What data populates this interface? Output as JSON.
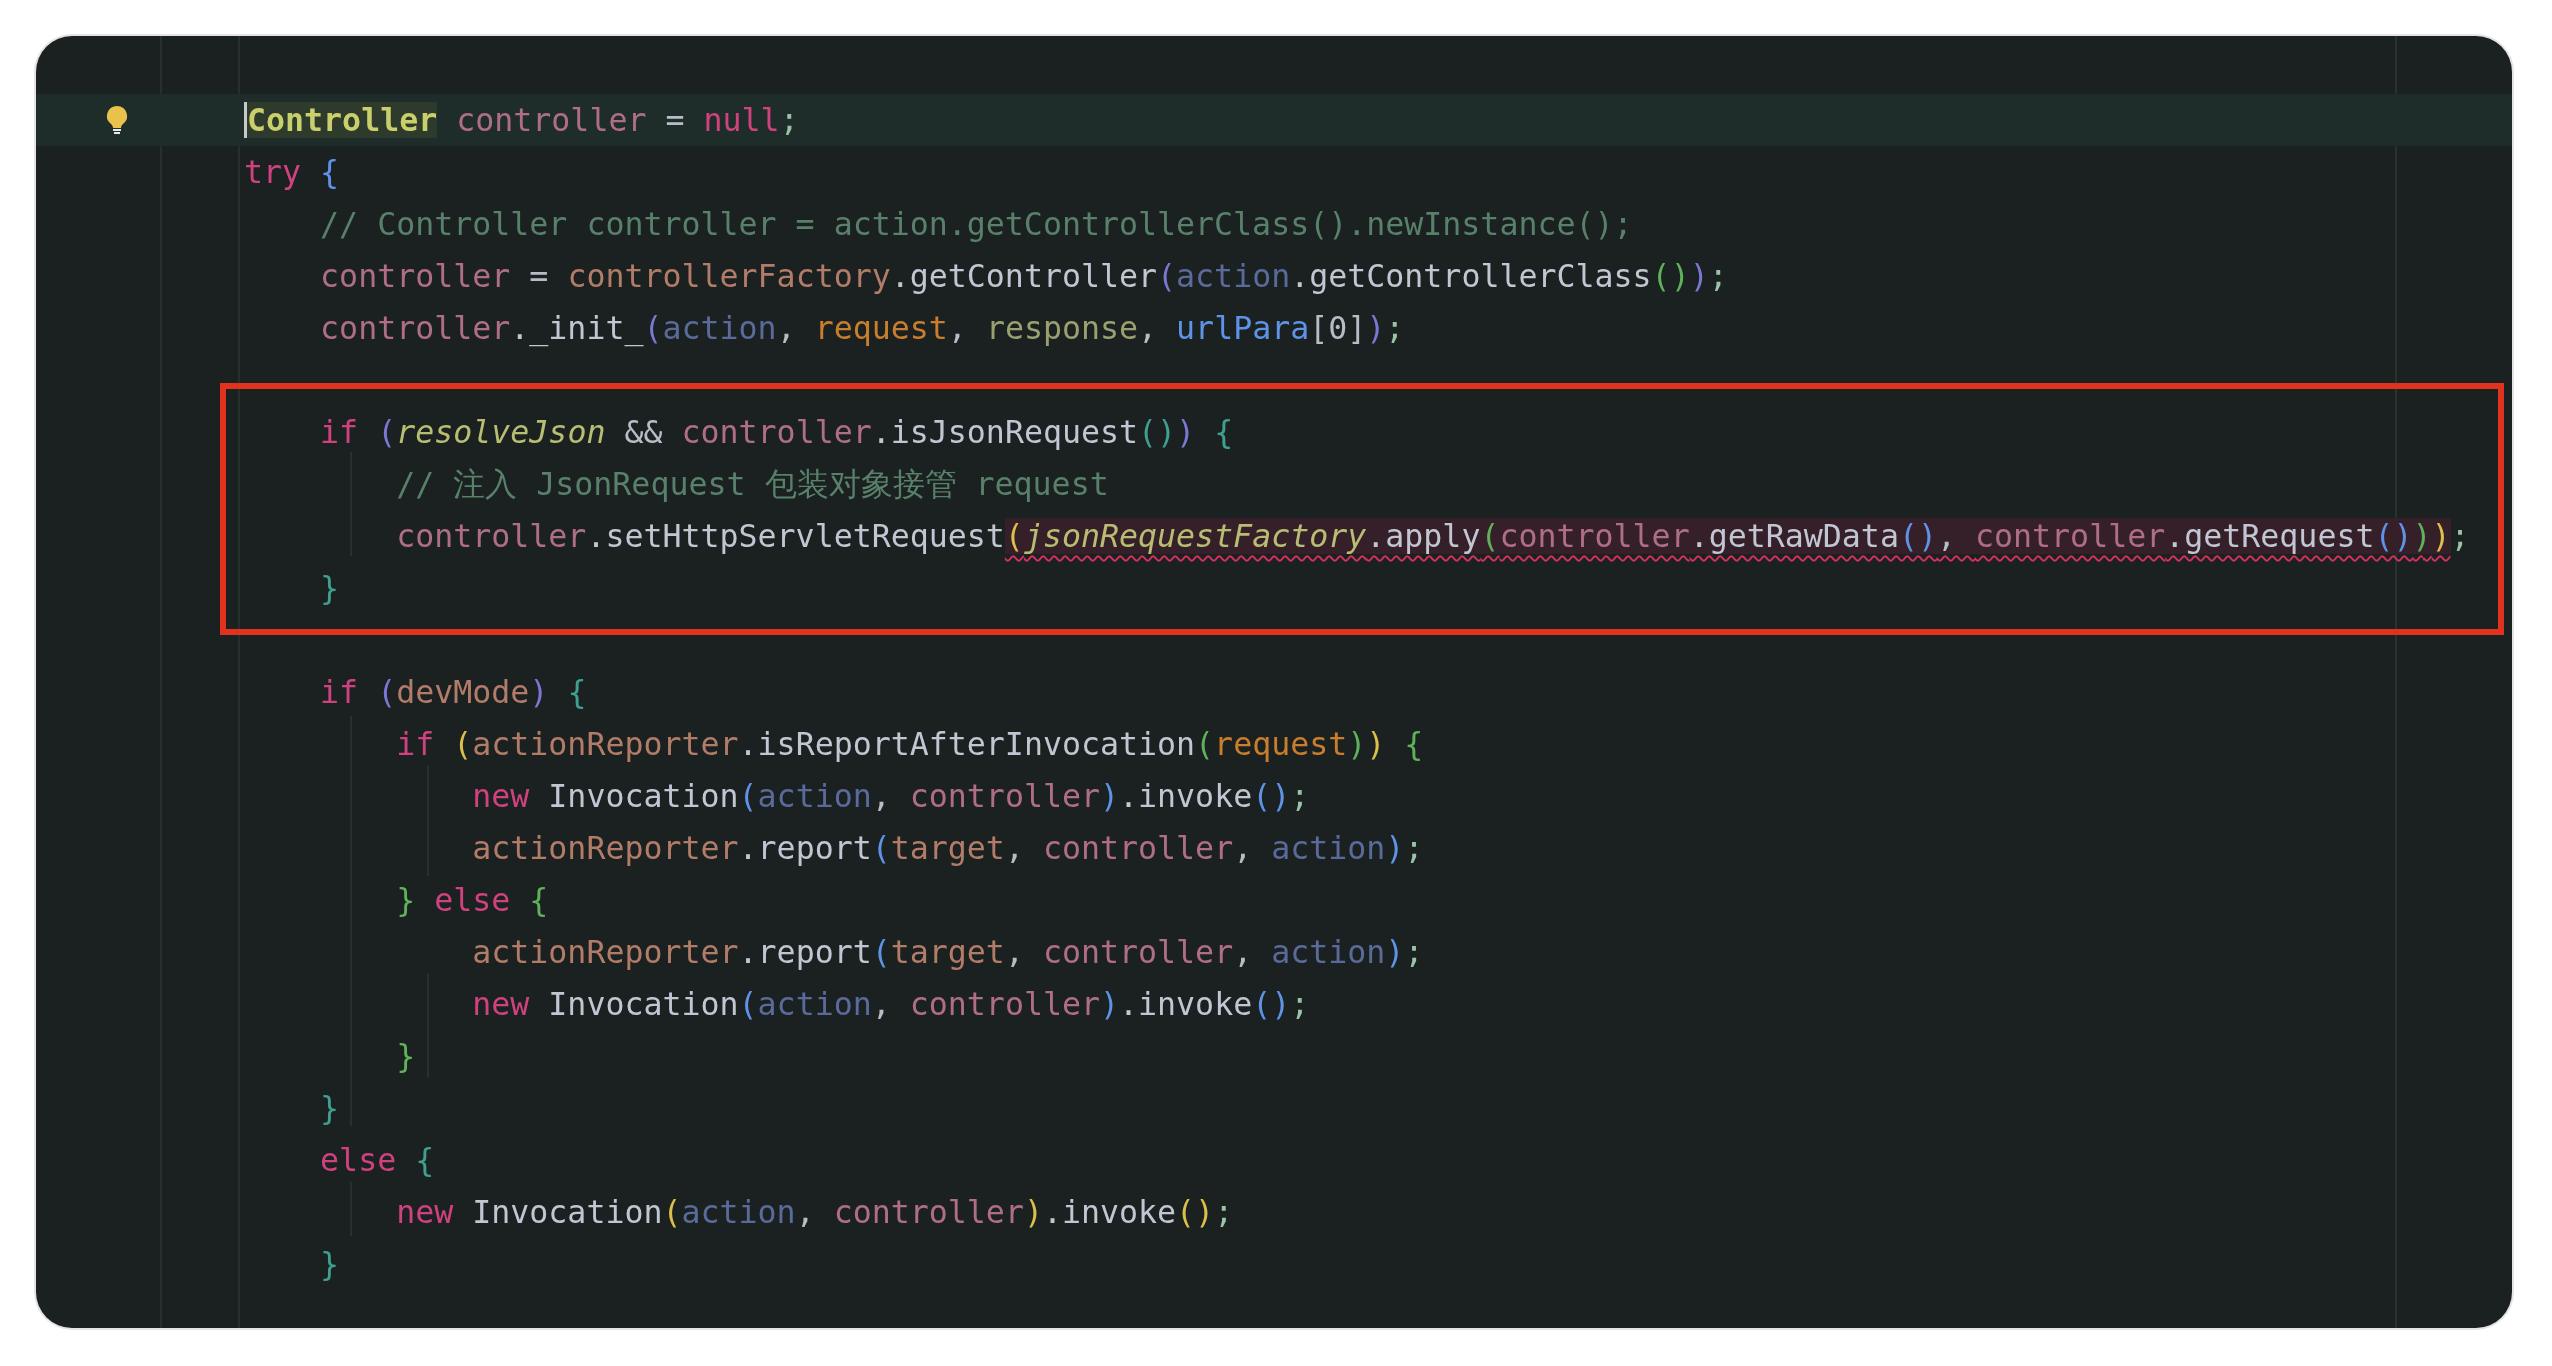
{
  "editor": {
    "blocks": [
      {
        "boxed": false,
        "lines": [
          {
            "kind": "code",
            "current": true,
            "tokens": [
              {
                "kind": "type_caret",
                "text": "Controller"
              },
              {
                "kind": "local",
                "text": " controller"
              },
              {
                "kind": "plain",
                "text": " = "
              },
              {
                "kind": "kw",
                "text": "null"
              },
              {
                "kind": "punct",
                "text": ";"
              }
            ]
          },
          {
            "kind": "code",
            "current": false,
            "tokens": [
              {
                "kind": "kw",
                "text": "try"
              },
              {
                "kind": "b2",
                "text": " {"
              }
            ]
          },
          {
            "kind": "code",
            "current": false,
            "tokens": [
              {
                "kind": "comment",
                "text": "    // Controller controller = action.getControllerClass().newInstance();"
              }
            ]
          },
          {
            "kind": "code",
            "current": false,
            "tokens": [
              {
                "kind": "local",
                "text": "    controller"
              },
              {
                "kind": "plain",
                "text": " = "
              },
              {
                "kind": "field",
                "text": "controllerFactory"
              },
              {
                "kind": "method",
                "text": ".getController"
              },
              {
                "kind": "b5",
                "text": "("
              },
              {
                "kind": "param",
                "text": "action"
              },
              {
                "kind": "method",
                "text": ".getControllerClass"
              },
              {
                "kind": "b3",
                "text": "()"
              },
              {
                "kind": "b5",
                "text": ")"
              },
              {
                "kind": "punct",
                "text": ";"
              }
            ]
          },
          {
            "kind": "code",
            "current": false,
            "tokens": [
              {
                "kind": "local",
                "text": "    controller"
              },
              {
                "kind": "method",
                "text": "._init_"
              },
              {
                "kind": "b5",
                "text": "("
              },
              {
                "kind": "param",
                "text": "action"
              },
              {
                "kind": "plain",
                "text": ", "
              },
              {
                "kind": "arg",
                "text": "request"
              },
              {
                "kind": "plain",
                "text": ", "
              },
              {
                "kind": "olive",
                "text": "response"
              },
              {
                "kind": "plain",
                "text": ", "
              },
              {
                "kind": "b2",
                "text": "urlPara"
              },
              {
                "kind": "plain",
                "text": "[0]"
              },
              {
                "kind": "b5",
                "text": ")"
              },
              {
                "kind": "punct",
                "text": ";"
              }
            ]
          },
          {
            "kind": "blank",
            "current": false
          }
        ]
      },
      {
        "boxed": true,
        "lines": [
          {
            "kind": "code",
            "current": false,
            "tokens": [
              {
                "kind": "kw",
                "text": "    if"
              },
              {
                "kind": "b5",
                "text": " ("
              },
              {
                "kind": "static",
                "text": "resolveJson"
              },
              {
                "kind": "plain",
                "text": " && "
              },
              {
                "kind": "local",
                "text": "controller"
              },
              {
                "kind": "method",
                "text": ".isJsonRequest"
              },
              {
                "kind": "b4",
                "text": "()"
              },
              {
                "kind": "b5",
                "text": ")"
              },
              {
                "kind": "b4",
                "text": " {"
              }
            ]
          },
          {
            "kind": "code",
            "current": false,
            "tokens": [
              {
                "kind": "comment",
                "text": "        // 注入 JsonRequest 包装对象接管 request"
              }
            ]
          },
          {
            "kind": "code",
            "current": false,
            "tokens": [
              {
                "kind": "local",
                "text": "        controller"
              },
              {
                "kind": "method",
                "text": ".setHttpServletRequest"
              },
              {
                "kind": "error",
                "tokens": [
                  {
                    "kind": "b1",
                    "text": "("
                  },
                  {
                    "kind": "static",
                    "text": "jsonRequestFactory"
                  },
                  {
                    "kind": "method",
                    "text": ".apply"
                  },
                  {
                    "kind": "b3",
                    "text": "("
                  },
                  {
                    "kind": "local",
                    "text": "controller"
                  },
                  {
                    "kind": "method",
                    "text": ".getRawData"
                  },
                  {
                    "kind": "b2",
                    "text": "()"
                  },
                  {
                    "kind": "plain",
                    "text": ", "
                  },
                  {
                    "kind": "local",
                    "text": "controller"
                  },
                  {
                    "kind": "method",
                    "text": ".getRequest"
                  },
                  {
                    "kind": "b2",
                    "text": "()"
                  },
                  {
                    "kind": "b3",
                    "text": ")"
                  },
                  {
                    "kind": "b1",
                    "text": ")"
                  }
                ]
              },
              {
                "kind": "punct",
                "text": ";"
              }
            ]
          },
          {
            "kind": "code",
            "current": false,
            "tokens": [
              {
                "kind": "b4",
                "text": "    }"
              }
            ]
          }
        ]
      },
      {
        "boxed": false,
        "lines": [
          {
            "kind": "blank",
            "current": false
          },
          {
            "kind": "code",
            "current": false,
            "tokens": [
              {
                "kind": "kw",
                "text": "    if"
              },
              {
                "kind": "b5",
                "text": " ("
              },
              {
                "kind": "field",
                "text": "devMode"
              },
              {
                "kind": "b5",
                "text": ")"
              },
              {
                "kind": "b4",
                "text": " {"
              }
            ]
          },
          {
            "kind": "code",
            "current": false,
            "tokens": [
              {
                "kind": "kw",
                "text": "        if"
              },
              {
                "kind": "b1",
                "text": " ("
              },
              {
                "kind": "field",
                "text": "actionReporter"
              },
              {
                "kind": "method",
                "text": ".isReportAfterInvocation"
              },
              {
                "kind": "b3",
                "text": "("
              },
              {
                "kind": "arg",
                "text": "request"
              },
              {
                "kind": "b3",
                "text": ")"
              },
              {
                "kind": "b1",
                "text": ")"
              },
              {
                "kind": "b3",
                "text": " {"
              }
            ]
          },
          {
            "kind": "code",
            "current": false,
            "tokens": [
              {
                "kind": "kw",
                "text": "            new"
              },
              {
                "kind": "method",
                "text": " Invocation"
              },
              {
                "kind": "b2",
                "text": "("
              },
              {
                "kind": "param",
                "text": "action"
              },
              {
                "kind": "plain",
                "text": ", "
              },
              {
                "kind": "local",
                "text": "controller"
              },
              {
                "kind": "b2",
                "text": ")"
              },
              {
                "kind": "method",
                "text": ".invoke"
              },
              {
                "kind": "b2",
                "text": "()"
              },
              {
                "kind": "punct",
                "text": ";"
              }
            ]
          },
          {
            "kind": "code",
            "current": false,
            "tokens": [
              {
                "kind": "field",
                "text": "            actionReporter"
              },
              {
                "kind": "method",
                "text": ".report"
              },
              {
                "kind": "b2",
                "text": "("
              },
              {
                "kind": "field",
                "text": "target"
              },
              {
                "kind": "plain",
                "text": ", "
              },
              {
                "kind": "local",
                "text": "controller"
              },
              {
                "kind": "plain",
                "text": ", "
              },
              {
                "kind": "param",
                "text": "action"
              },
              {
                "kind": "b2",
                "text": ")"
              },
              {
                "kind": "punct",
                "text": ";"
              }
            ]
          },
          {
            "kind": "code",
            "current": false,
            "tokens": [
              {
                "kind": "b3",
                "text": "        }"
              },
              {
                "kind": "kw",
                "text": " else"
              },
              {
                "kind": "b3",
                "text": " {"
              }
            ]
          },
          {
            "kind": "code",
            "current": false,
            "tokens": [
              {
                "kind": "field",
                "text": "            actionReporter"
              },
              {
                "kind": "method",
                "text": ".report"
              },
              {
                "kind": "b2",
                "text": "("
              },
              {
                "kind": "field",
                "text": "target"
              },
              {
                "kind": "plain",
                "text": ", "
              },
              {
                "kind": "local",
                "text": "controller"
              },
              {
                "kind": "plain",
                "text": ", "
              },
              {
                "kind": "param",
                "text": "action"
              },
              {
                "kind": "b2",
                "text": ")"
              },
              {
                "kind": "punct",
                "text": ";"
              }
            ]
          },
          {
            "kind": "code",
            "current": false,
            "tokens": [
              {
                "kind": "kw",
                "text": "            new"
              },
              {
                "kind": "method",
                "text": " Invocation"
              },
              {
                "kind": "b2",
                "text": "("
              },
              {
                "kind": "param",
                "text": "action"
              },
              {
                "kind": "plain",
                "text": ", "
              },
              {
                "kind": "local",
                "text": "controller"
              },
              {
                "kind": "b2",
                "text": ")"
              },
              {
                "kind": "method",
                "text": ".invoke"
              },
              {
                "kind": "b2",
                "text": "()"
              },
              {
                "kind": "punct",
                "text": ";"
              }
            ]
          },
          {
            "kind": "code",
            "current": false,
            "tokens": [
              {
                "kind": "b3",
                "text": "        }"
              }
            ]
          },
          {
            "kind": "code",
            "current": false,
            "tokens": [
              {
                "kind": "b4",
                "text": "    }"
              }
            ]
          },
          {
            "kind": "code",
            "current": false,
            "tokens": [
              {
                "kind": "kw",
                "text": "    else"
              },
              {
                "kind": "b4",
                "text": " {"
              }
            ]
          },
          {
            "kind": "code",
            "current": false,
            "tokens": [
              {
                "kind": "kw",
                "text": "        new"
              },
              {
                "kind": "method",
                "text": " Invocation"
              },
              {
                "kind": "b1",
                "text": "("
              },
              {
                "kind": "param",
                "text": "action"
              },
              {
                "kind": "plain",
                "text": ", "
              },
              {
                "kind": "local",
                "text": "controller"
              },
              {
                "kind": "b1",
                "text": ")"
              },
              {
                "kind": "method",
                "text": ".invoke"
              },
              {
                "kind": "b1",
                "text": "()"
              },
              {
                "kind": "punct",
                "text": ";"
              }
            ]
          },
          {
            "kind": "code",
            "current": false,
            "tokens": [
              {
                "kind": "b4",
                "text": "    }"
              }
            ]
          }
        ]
      }
    ]
  }
}
